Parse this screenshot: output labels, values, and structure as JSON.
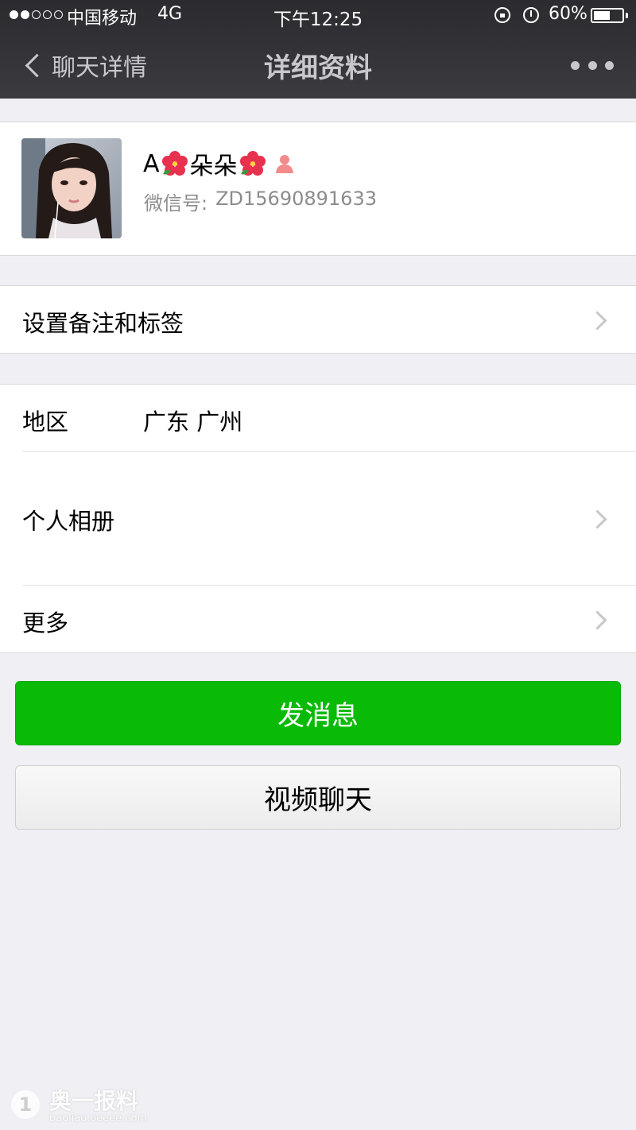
{
  "status_bar": {
    "carrier": "中国移动",
    "network": "4G",
    "time": "下午12:25",
    "battery": "60%",
    "battery_level": 0.6,
    "signal_strength": 2,
    "signal_max": 5
  },
  "nav": {
    "back_label": "聊天详情",
    "title": "详细资料",
    "more_icon": "more-dots-icon"
  },
  "profile": {
    "name_prefix": "A",
    "name_main": "朵朵",
    "flower_icon": "hibiscus-emoji-icon",
    "gender_icon": "female-icon",
    "wechat_id_label": "微信号:",
    "wechat_id_value": "ZD15690891633"
  },
  "rows": {
    "remark_tags": "设置备注和标签",
    "region_label": "地区",
    "region_value": "广东 广州",
    "album": "个人相册",
    "more": "更多"
  },
  "buttons": {
    "send_message": "发消息",
    "video_chat": "视频聊天"
  },
  "watermark": {
    "badge": "1",
    "text": "奥一报料",
    "url": "baoliao.oeeee.com"
  },
  "colors": {
    "accent_green": "#09bb07",
    "navbar": "#3b3b40",
    "page_bg": "#efeff4"
  }
}
